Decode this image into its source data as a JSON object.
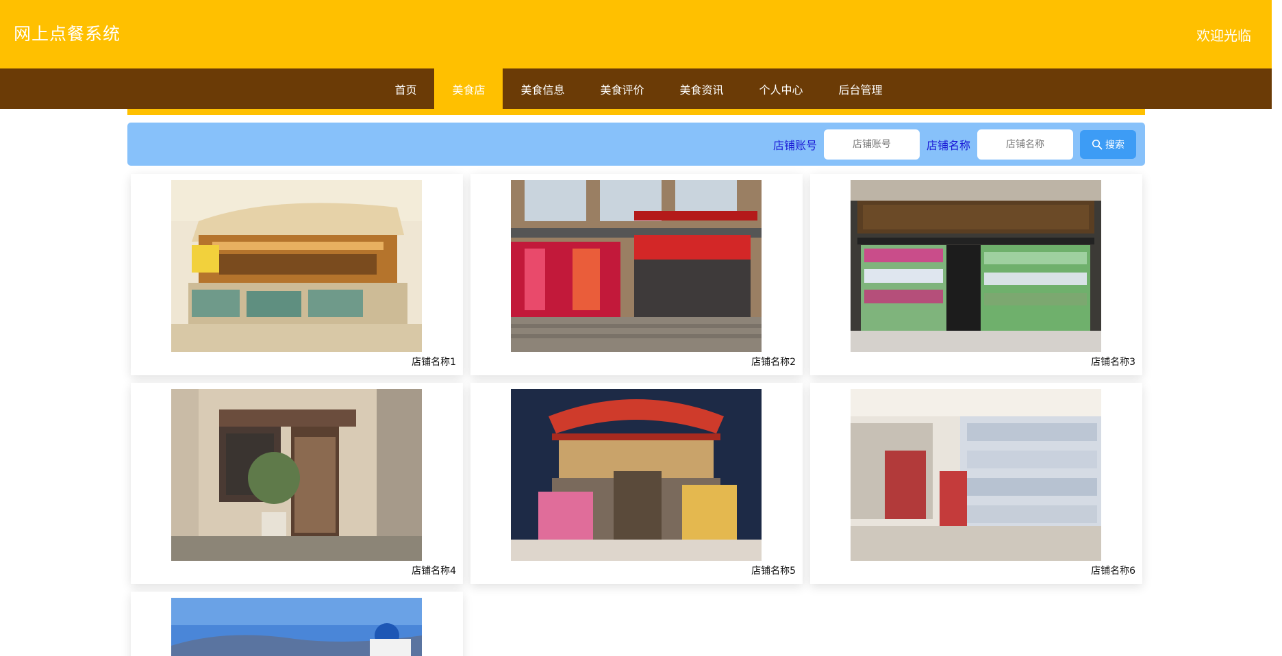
{
  "header": {
    "title": "网上点餐系统",
    "welcome": "欢迎光临"
  },
  "nav": {
    "items": [
      {
        "label": "首页",
        "active": false
      },
      {
        "label": "美食店",
        "active": true
      },
      {
        "label": "美食信息",
        "active": false
      },
      {
        "label": "美食评价",
        "active": false
      },
      {
        "label": "美食资讯",
        "active": false
      },
      {
        "label": "个人中心",
        "active": false
      },
      {
        "label": "后台管理",
        "active": false
      }
    ]
  },
  "search": {
    "account_label": "店铺账号",
    "account_placeholder": "店铺账号",
    "name_label": "店铺名称",
    "name_placeholder": "店铺名称",
    "button_label": "搜索"
  },
  "shops": [
    {
      "name": "店铺名称1",
      "image": "restaurant-interior"
    },
    {
      "name": "店铺名称2",
      "image": "storefront-street"
    },
    {
      "name": "店铺名称3",
      "image": "price-wise-discount-store"
    },
    {
      "name": "店铺名称4",
      "image": "flower-shop-entrance"
    },
    {
      "name": "店铺名称5",
      "image": "disney-store"
    },
    {
      "name": "店铺名称6",
      "image": "supermarket-aisle"
    },
    {
      "name": "",
      "image": "coastal-town"
    }
  ],
  "colors": {
    "header_bg": "#ffc000",
    "nav_bg": "#6b3b06",
    "search_bg": "#87c1fa",
    "search_label": "#1a1ad6",
    "search_button": "#3d9cf5"
  }
}
